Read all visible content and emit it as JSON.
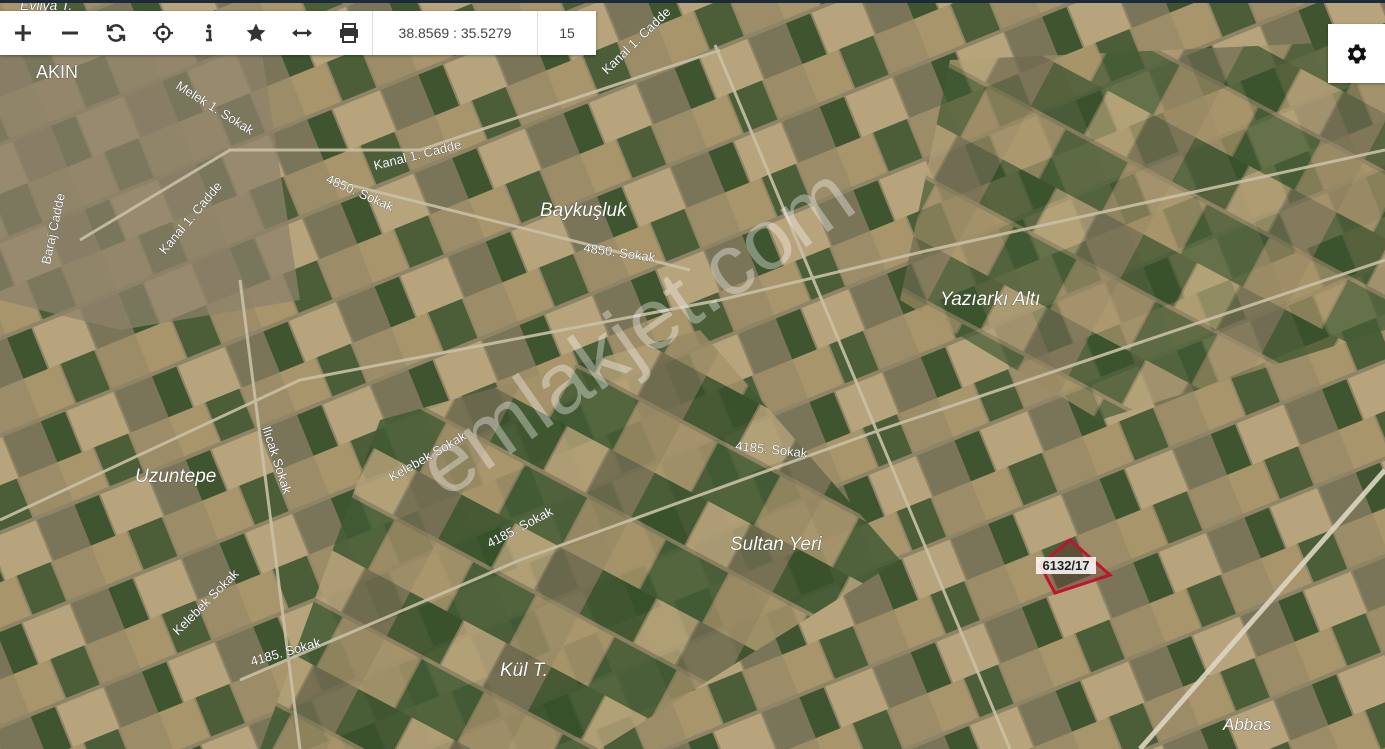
{
  "toolbar": {
    "buttons": [
      {
        "name": "zoom-in-button",
        "icon": "plus-icon"
      },
      {
        "name": "zoom-out-button",
        "icon": "minus-icon"
      },
      {
        "name": "refresh-button",
        "icon": "refresh-icon"
      },
      {
        "name": "locate-button",
        "icon": "crosshair-icon"
      },
      {
        "name": "info-button",
        "icon": "info-icon"
      },
      {
        "name": "favorite-button",
        "icon": "star-icon"
      },
      {
        "name": "measure-button",
        "icon": "arrows-horizontal-icon"
      },
      {
        "name": "print-button",
        "icon": "printer-icon"
      }
    ],
    "coordinates": "38.8569 : 35.5279",
    "zoom_level": "15"
  },
  "settings": {
    "icon": "gear-icon"
  },
  "map": {
    "watermark": "emlakjet.com",
    "parcel_label": "6132/17",
    "place_labels": [
      "AKIN",
      "Baykuşluk",
      "Yazıarkı Altı",
      "Uzuntepe",
      "Sultan Yeri",
      "Kül T.",
      "Abbas",
      "Evliya T."
    ],
    "road_labels": [
      "Kanal 1. Cadde",
      "Melek 1. Sokak",
      "Baraj Cadde",
      "4850. Sokak",
      "Kelebek Sokak",
      "Ilıcak Sokak",
      "4185. Sokak"
    ],
    "colors": {
      "parcel_outline": "#c0142c",
      "field_green": "#3e5a2e",
      "field_tan": "#b09a70"
    }
  }
}
